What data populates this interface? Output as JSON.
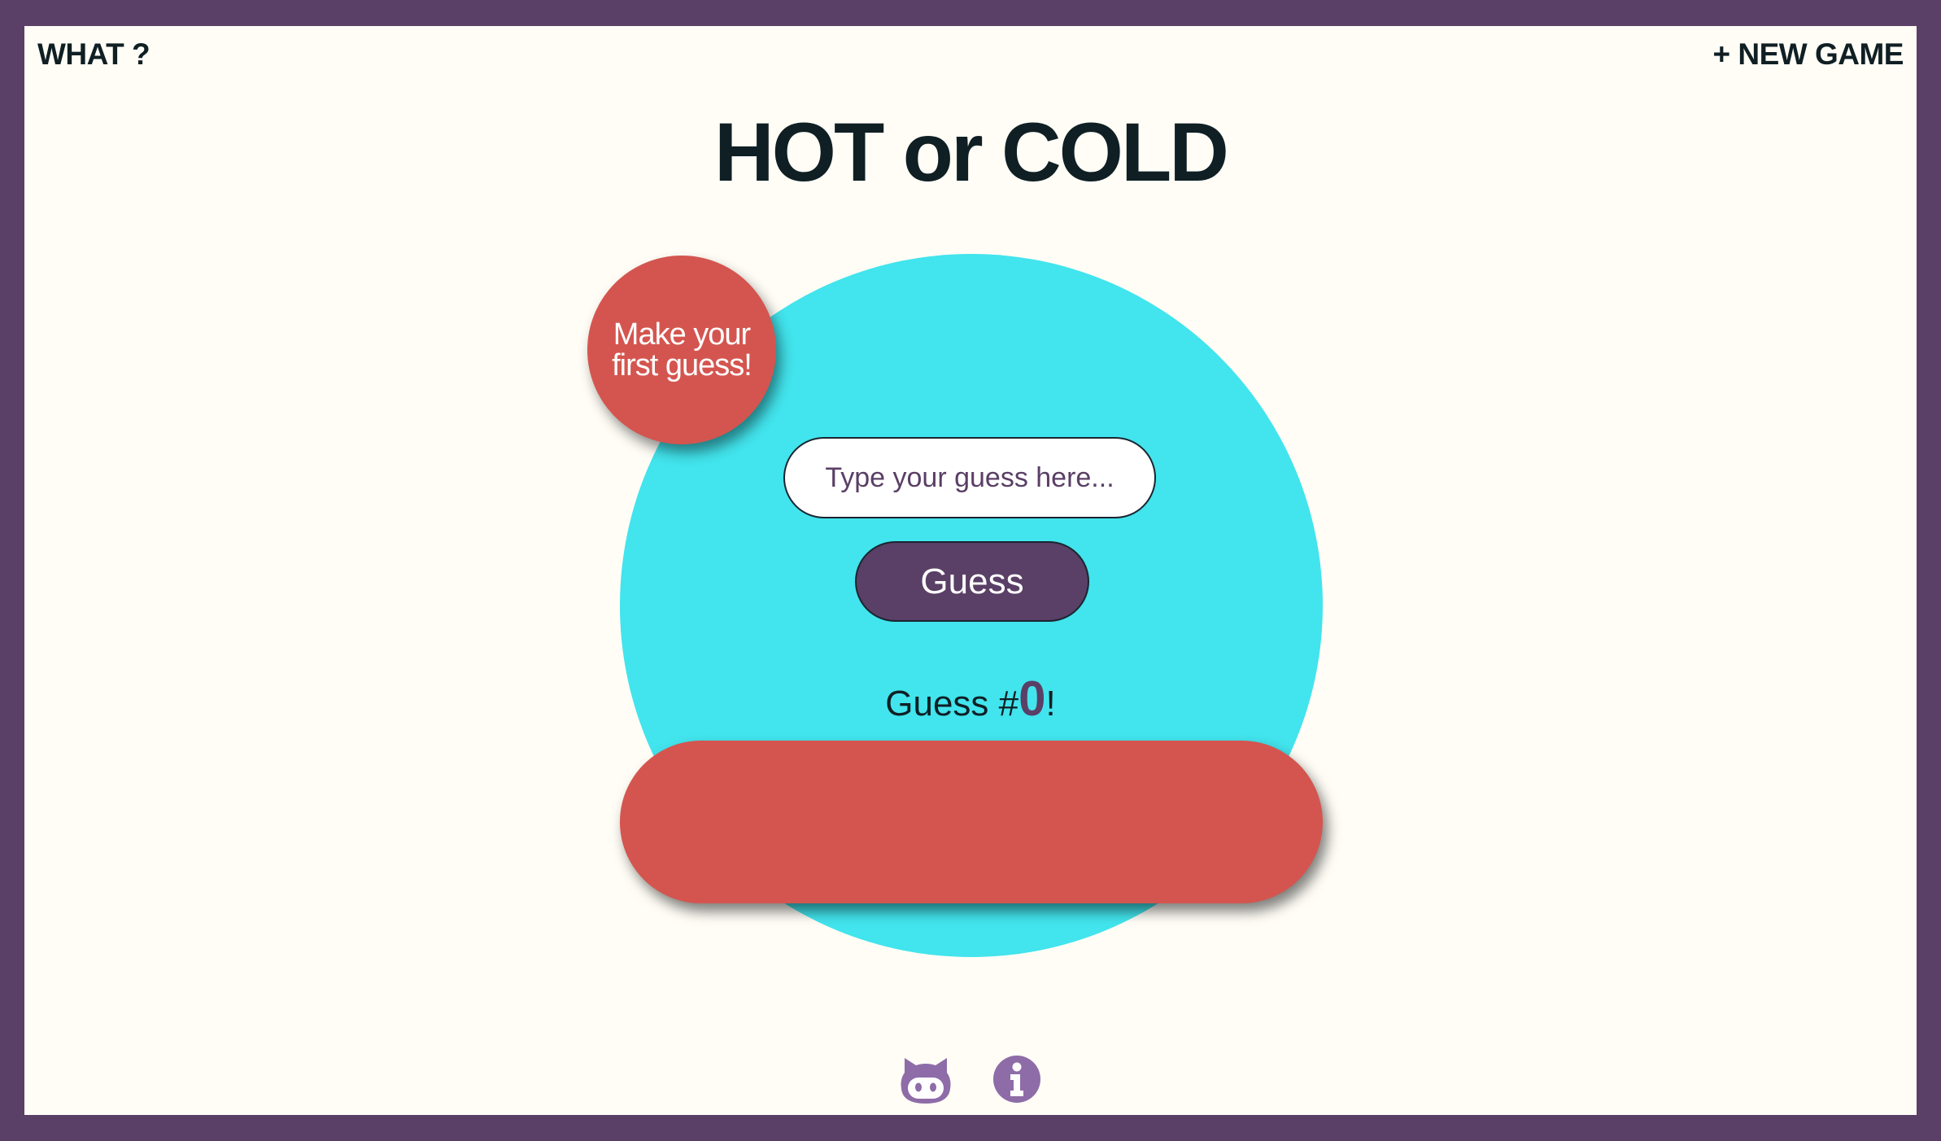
{
  "nav": {
    "what_label": "WHAT ?",
    "new_game_label": "+ NEW GAME"
  },
  "title": "HOT or COLD",
  "feedback": "Make your first guess!",
  "guess_input": {
    "placeholder": "Type your guess here...",
    "value": ""
  },
  "guess_button_label": "Guess",
  "counter": {
    "prefix": "Guess #",
    "count": "0",
    "suffix": "!"
  },
  "footer": {
    "icons": [
      "github-icon",
      "info-icon"
    ]
  },
  "colors": {
    "frame": "#5a3f66",
    "background": "#fffdf6",
    "circle": "#42e4ed",
    "accent_red": "#d4554f",
    "button": "#5a3f66",
    "text_dark": "#0f1f24",
    "icon": "#8e6ca8"
  }
}
